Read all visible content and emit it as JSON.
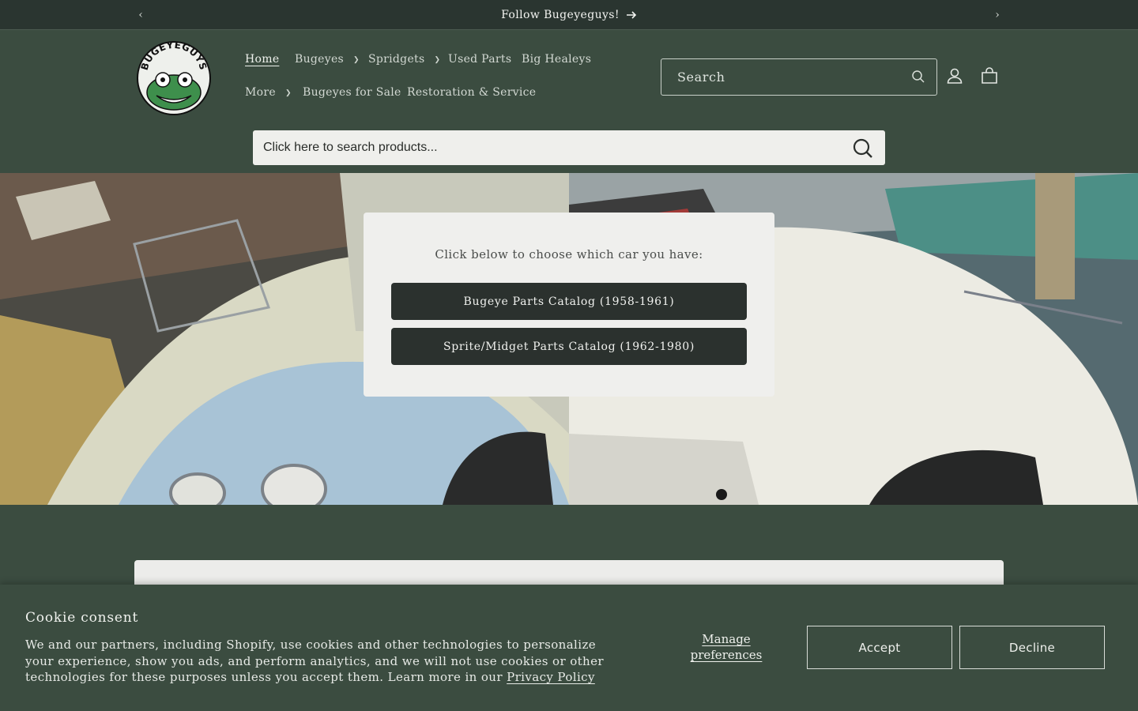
{
  "announcement": {
    "text": "Follow Bugeyeguys!"
  },
  "brand": {
    "logo_text": "BUGEYEGUYS"
  },
  "nav": {
    "home": "Home",
    "bugeyes": "Bugeyes",
    "spridgets": "Spridgets",
    "used_parts": "Used Parts",
    "big_healeys": "Big Healeys",
    "more": "More",
    "bugeyes_for_sale": "Bugeyes for Sale",
    "restoration": "Restoration & Service"
  },
  "header_search": {
    "placeholder": "Search"
  },
  "product_search": {
    "placeholder": "Click here to search products..."
  },
  "hero": {
    "prompt": "Click below to choose which car you have:",
    "buttons": [
      "Bugeye Parts Catalog (1958-1961)",
      "Sprite/Midget Parts Catalog (1962-1980)"
    ]
  },
  "cookie": {
    "title": "Cookie consent",
    "body": "We and our partners, including Shopify, use cookies and other technologies to personalize your experience, show you ads, and perform analytics, and we will not use cookies or other technologies for these purposes unless you accept them. Learn more in our ",
    "policy_link": "Privacy Policy",
    "manage": "Manage preferences",
    "accept": "Accept",
    "decline": "Decline"
  },
  "colors": {
    "background": "#3b4c40",
    "announcement_bar": "#2a3530",
    "button_dark": "#2b312e",
    "card": "#efefed"
  }
}
